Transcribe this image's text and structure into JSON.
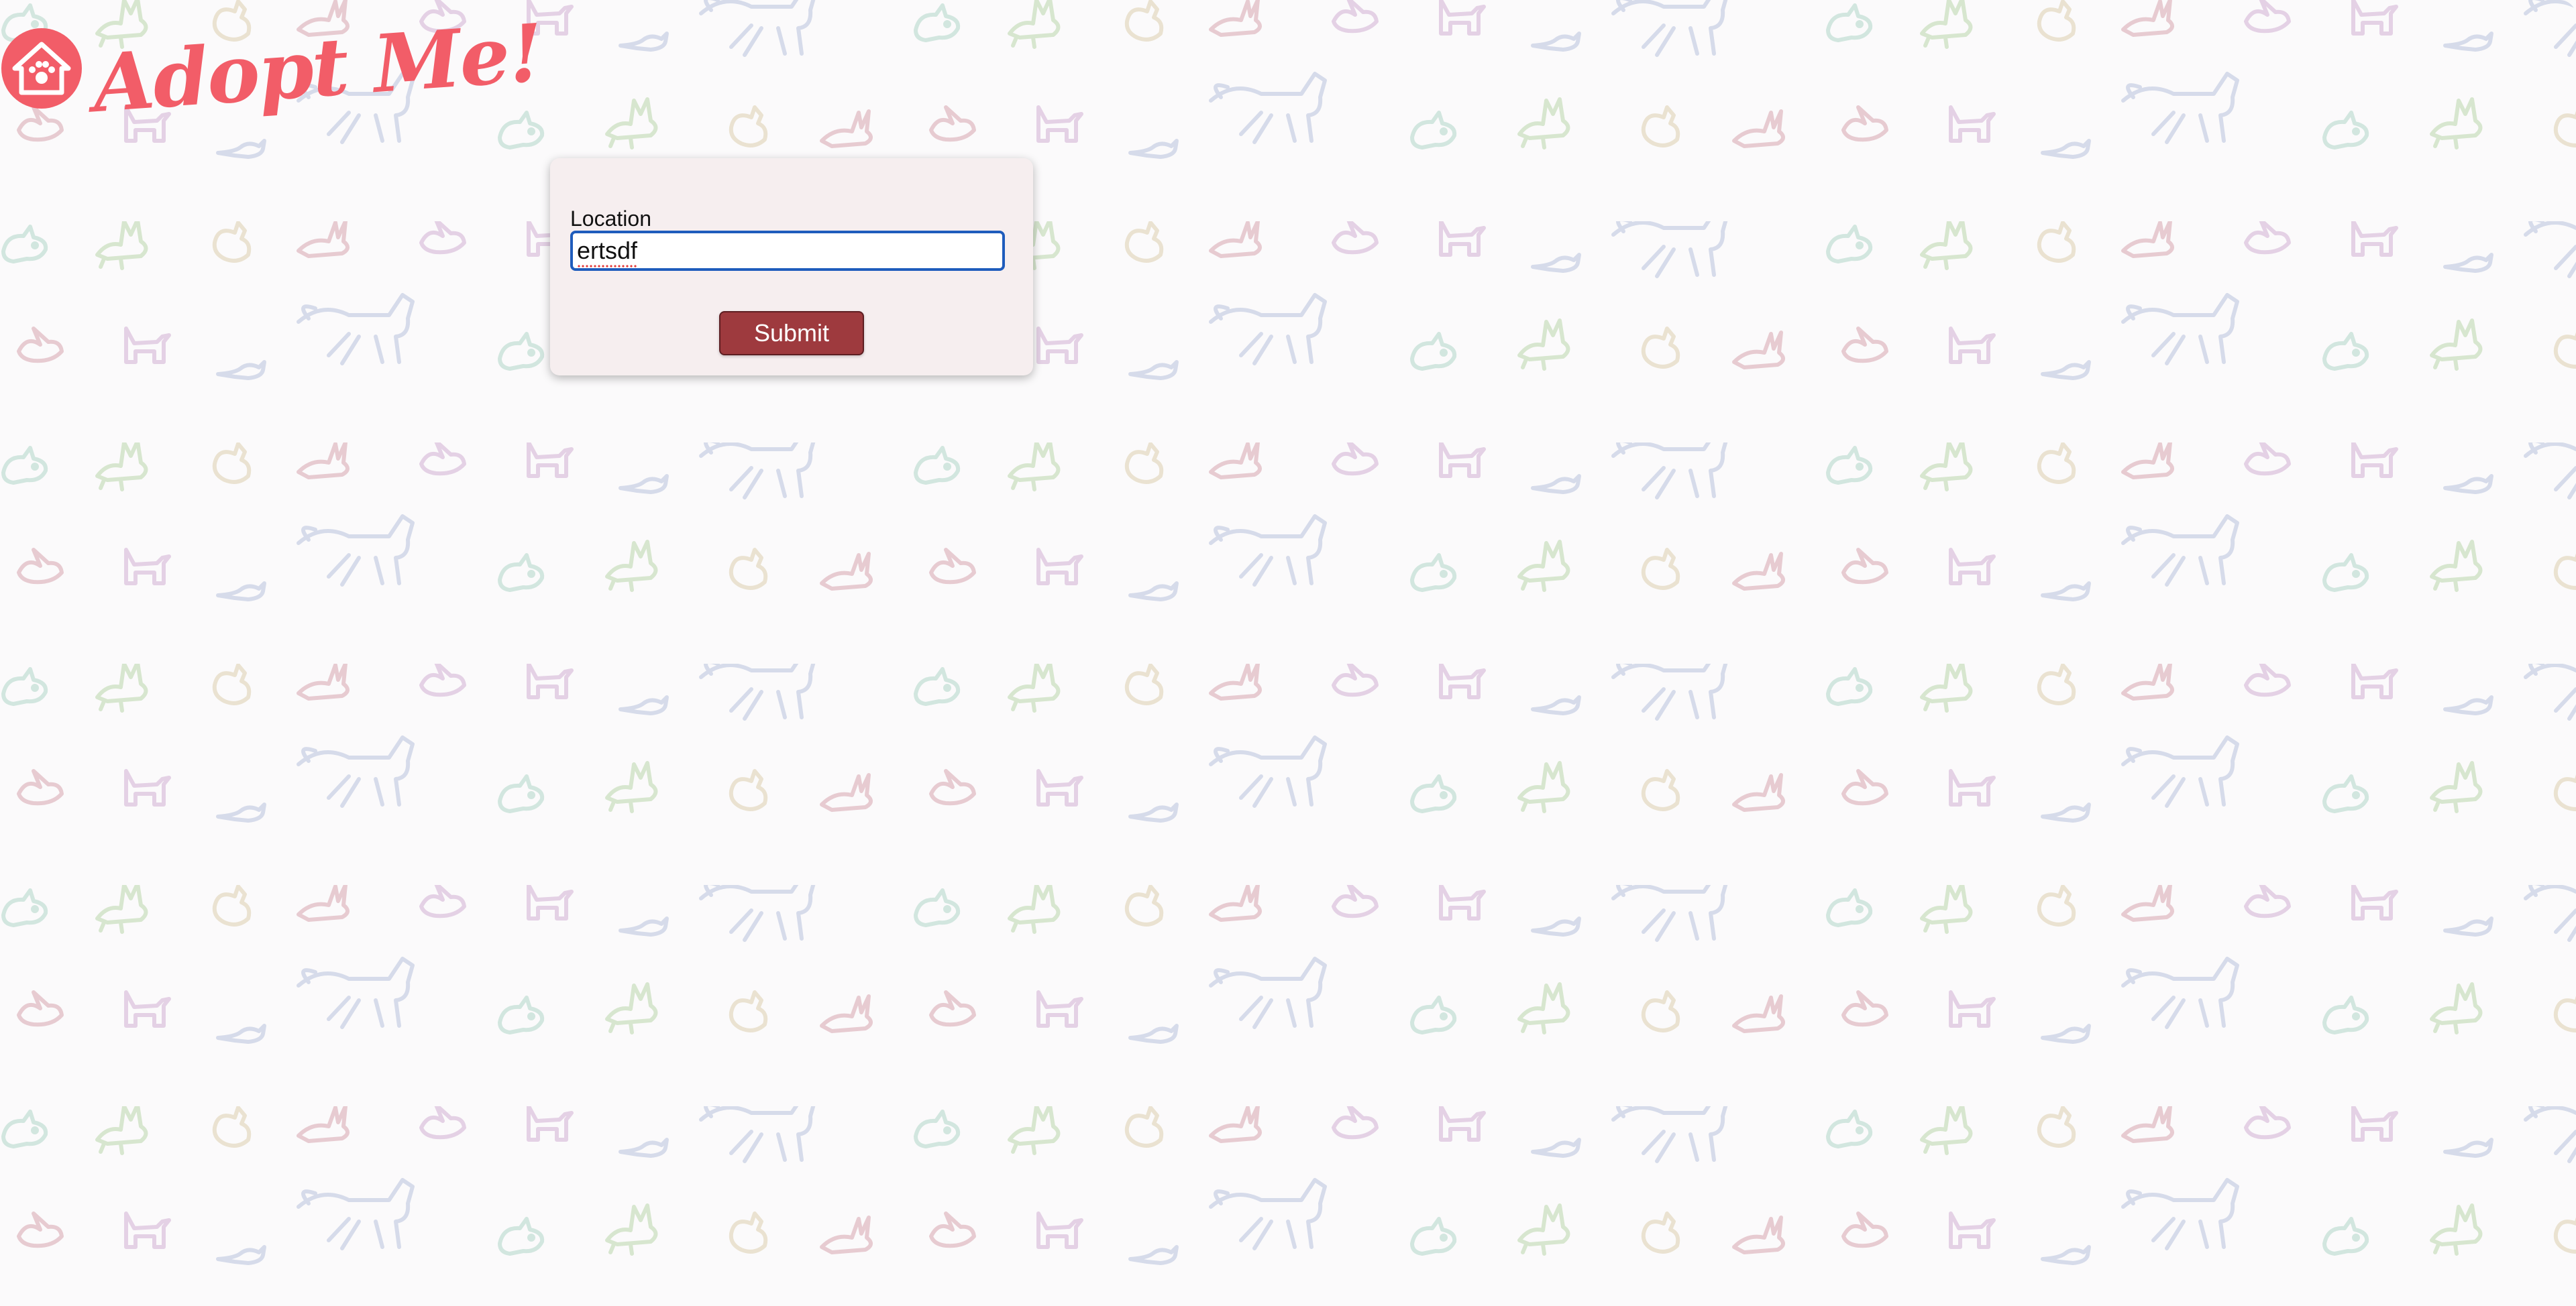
{
  "header": {
    "logo_text": "Adopt Me!",
    "logo_icon": "house-paw-icon"
  },
  "search_form": {
    "location_label": "Location",
    "location_value": "ertsdf",
    "submit_label": "Submit"
  },
  "background": {
    "pattern": "animal-doodles",
    "animals": [
      "dog",
      "dragon",
      "chicken",
      "rabbit",
      "bird",
      "cat",
      "mouse",
      "horse"
    ],
    "colors": [
      "#7fbfa6",
      "#8fbf74",
      "#c9b27a",
      "#c06c7c",
      "#b77db8",
      "#8a9cc8"
    ]
  },
  "colors": {
    "brand": "#f25d68",
    "button": "#9e3a3e",
    "card": "#f6eeef",
    "focus": "#1f5cbc"
  }
}
